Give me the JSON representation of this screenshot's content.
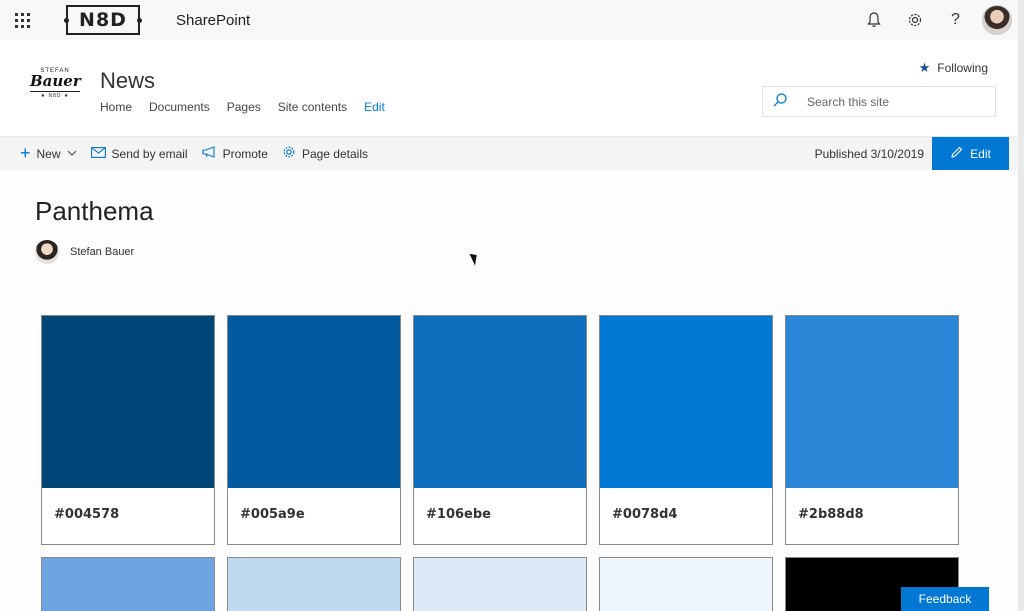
{
  "suite": {
    "app_name": "SharePoint",
    "logo_text": "N8D",
    "icons": [
      "waffle-icon",
      "bell-icon",
      "gear-icon",
      "help-icon"
    ],
    "help_glyph": "?"
  },
  "site": {
    "title": "News",
    "logo_top": "STEFAN",
    "logo_main": "Bauer",
    "logo_bottom": "★ N8D ★",
    "nav": [
      "Home",
      "Documents",
      "Pages",
      "Site contents",
      "Edit"
    ],
    "following_label": "Following",
    "search_placeholder": "Search this site"
  },
  "commandbar": {
    "new_label": "New",
    "send_label": "Send by email",
    "promote_label": "Promote",
    "details_label": "Page details",
    "published": "Published 3/10/2019",
    "edit_label": "Edit"
  },
  "page": {
    "title": "Panthema",
    "author": "Stefan Bauer"
  },
  "swatches_row1": [
    {
      "color": "#004578",
      "label": "#004578"
    },
    {
      "color": "#005a9e",
      "label": "#005a9e"
    },
    {
      "color": "#106ebe",
      "label": "#106ebe"
    },
    {
      "color": "#0078d4",
      "label": "#0078d4"
    },
    {
      "color": "#2b88d8",
      "label": "#2b88d8"
    }
  ],
  "swatches_row2": [
    {
      "color": "#6ea5e0"
    },
    {
      "color": "#bfdaf0"
    },
    {
      "color": "#dceaf7"
    },
    {
      "color": "#eef5fc"
    },
    {
      "color": "#000000"
    }
  ],
  "feedback_label": "Feedback",
  "colors": {
    "accent": "#0078d4",
    "link": "#0078d4"
  }
}
